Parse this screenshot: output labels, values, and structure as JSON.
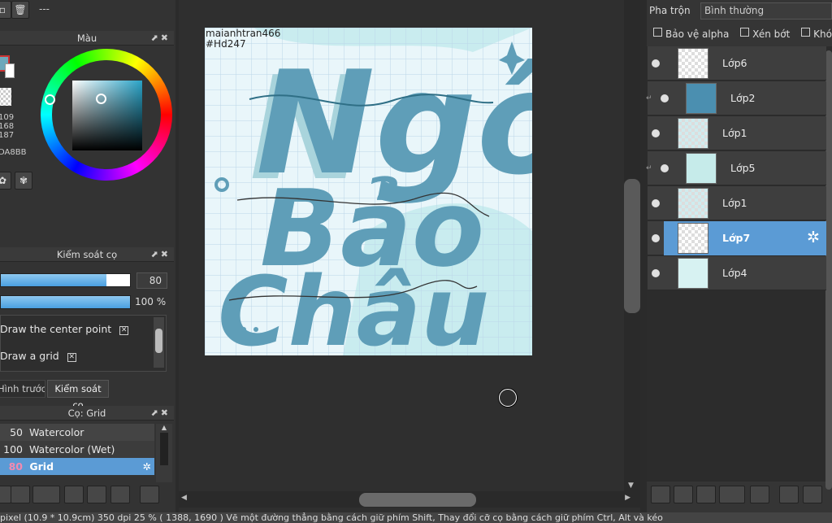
{
  "left": {
    "top_text": "---",
    "color_panel": {
      "title": "Màu",
      "rgb_r": "109",
      "rgb_g": "168",
      "rgb_b": "187",
      "hex": "DA8BB",
      "fg_color": "#6da8bb",
      "bg_color": "#ffffff"
    },
    "brush_control": {
      "title": "Kiểm soát cọ",
      "size_value": "80",
      "size_fill": 0.82,
      "opacity_value": "100 %",
      "opacity_fill": 1.0,
      "options": [
        {
          "label": "Draw the center point"
        },
        {
          "label": "Draw a grid"
        }
      ],
      "tabs": [
        "Hình trước cọ",
        "Kiểm soát cọ"
      ]
    },
    "brush_panel": {
      "title": "Cọ: Grid",
      "items": [
        {
          "size": "50",
          "name": "Watercolor"
        },
        {
          "size": "100",
          "name": "Watercolor (Wet)"
        },
        {
          "size": "80",
          "name": "Grid"
        }
      ]
    }
  },
  "canvas": {
    "watermark": "maianhtran466",
    "hashtag": "#Hd247",
    "art_lines": [
      "Ngô",
      "Bảo",
      "Châu"
    ]
  },
  "layers": {
    "blend_label": "Pha trộn",
    "blend_value": "Bình thường",
    "protect_alpha": "Bảo vệ alpha",
    "clipping": "Xén bớt",
    "lock": "Khóa",
    "items": [
      {
        "name": "Lớp6"
      },
      {
        "name": "Lớp2"
      },
      {
        "name": "Lớp1"
      },
      {
        "name": "Lớp5"
      },
      {
        "name": "Lớp1"
      },
      {
        "name": "Lớp7"
      },
      {
        "name": "Lớp4"
      }
    ]
  },
  "status": {
    "text": "pixel  (10.9 * 10.9cm)  350 dpi  25 %  ( 1388, 1690 )  Vẽ một đường thẳng bằng cách giữ phím Shift, Thay đổi cỡ cọ bằng cách giữ phím Ctrl, Alt và kéo"
  },
  "colors": {
    "accent": "#5b9bd5",
    "art_blue": "#5f9eb8",
    "art_shadow": "#a9d4dc",
    "art_dark": "#2f6f86"
  }
}
